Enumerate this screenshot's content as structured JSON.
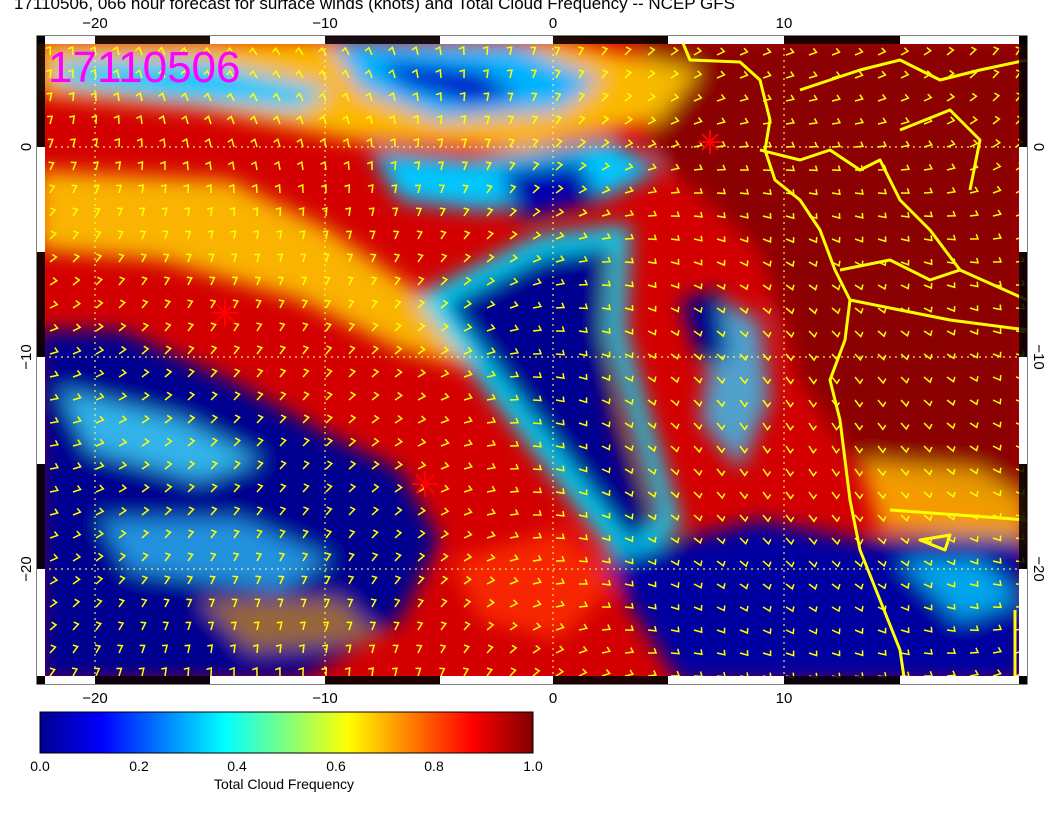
{
  "title": "17110506, 066 hour forecast for surface winds (knots) and Total Cloud Frequency -- NCEP GFS",
  "date_stamp": "17110506",
  "map": {
    "x_ticks": [
      "−20",
      "−10",
      "0",
      "10"
    ],
    "y_ticks": [
      "0",
      "−10",
      "−20"
    ],
    "lon_range": [
      -22.5,
      20.5
    ],
    "lat_range": [
      5.0,
      -25.5
    ],
    "coastline_color": "#ffff00",
    "wind_barb_color": "#ffff00",
    "marker_color": "#ff0000",
    "date_stamp_color": "#ff00ff"
  },
  "colorbar": {
    "title": "Total Cloud Frequency",
    "tick_labels": [
      "0.0",
      "0.2",
      "0.4",
      "0.6",
      "0.8",
      "1.0"
    ],
    "colormap": [
      "#00008f",
      "#0000ff",
      "#00ffff",
      "#ffff00",
      "#ff0000",
      "#800000"
    ]
  }
}
